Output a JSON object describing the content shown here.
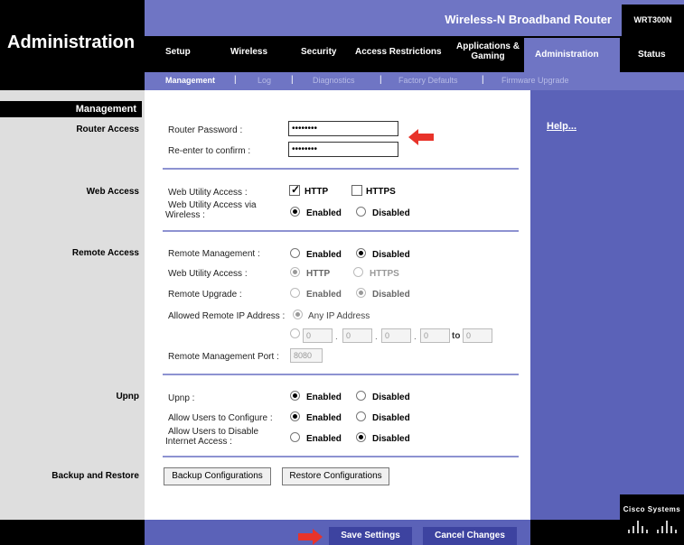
{
  "header": {
    "page_title": "Administration",
    "product_name": "Wireless-N Broadband Router",
    "model": "WRT300N"
  },
  "nav": {
    "items": [
      "Setup",
      "Wireless",
      "Security",
      "Access Restrictions",
      "Applications &\nGaming",
      "Administration",
      "Status"
    ],
    "active": "Administration"
  },
  "subnav": {
    "items": [
      "Management",
      "Log",
      "Diagnostics",
      "Factory Defaults",
      "Firmware Upgrade"
    ],
    "active": "Management",
    "separator": "|"
  },
  "sections": {
    "management": "Management",
    "router_access": "Router Access",
    "web_access": "Web Access",
    "remote_access": "Remote Access",
    "upnp": "Upnp",
    "backup_restore": "Backup and Restore"
  },
  "router_access": {
    "password_label": "Router Password :",
    "password_value": "••••••••",
    "confirm_label": "Re-enter to  confirm :",
    "confirm_value": "••••••••"
  },
  "web_access": {
    "utility_label": "Web Utility Access :",
    "http_label": "HTTP",
    "https_label": "HTTPS",
    "http_checked": true,
    "https_checked": false,
    "wireless_label_1": "Web Utility Access via",
    "wireless_label_2": "Wireless :",
    "enabled_label": "Enabled",
    "disabled_label": "Disabled",
    "wireless_value": "Enabled"
  },
  "remote_access": {
    "mgmt_label": "Remote  Management :",
    "mgmt_value": "Disabled",
    "utility_label": "Web Utility Access :",
    "utility_value": "HTTP",
    "upgrade_label": "Remote Upgrade :",
    "upgrade_value": "Disabled",
    "allowed_ip_label": "Allowed Remote IP Address :",
    "any_ip_label": "Any IP Address",
    "ip_octets": [
      "0",
      "0",
      "0",
      "0"
    ],
    "ip_to": "0",
    "to_label": "to",
    "port_label": "Remote Management Port :",
    "port_value": "8080"
  },
  "upnp": {
    "upnp_label": "Upnp :",
    "upnp_value": "Enabled",
    "configure_label": "Allow Users to Configure :",
    "configure_value": "Enabled",
    "disable_label_1": "Allow Users to Disable",
    "disable_label_2": "Internet Access :",
    "disable_value": "Disabled"
  },
  "backup": {
    "backup_button": "Backup Configurations",
    "restore_button": "Restore Configurations"
  },
  "help": {
    "link": "Help..."
  },
  "footer": {
    "save_button": "Save Settings",
    "cancel_button": "Cancel Changes",
    "logo_text": "Cisco Systems"
  },
  "colors": {
    "accent_blue": "#6f75c4",
    "panel_blue": "#5b62b8",
    "arrow_red": "#e8332a"
  }
}
